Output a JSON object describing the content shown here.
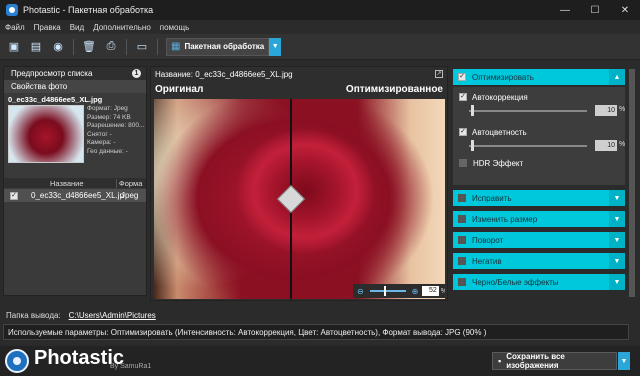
{
  "window": {
    "title": "Photastic - Пакетная обработка",
    "minimize": "—",
    "maximize": "☐",
    "close": "✕"
  },
  "menu": [
    "Файл",
    "Правка",
    "Вид",
    "Дополнительно",
    "помощь"
  ],
  "toolbar": {
    "mode_label": "Пакетная обработка",
    "icons": [
      "open-image-icon",
      "open-folder-icon",
      "webcam-icon",
      "delete-icon",
      "print-icon",
      "window-icon"
    ]
  },
  "left_panel": {
    "tab_preview": "Предпросмотр списка",
    "count": "1",
    "tab_props": "Свойства фото",
    "thumb_name": "0_ec33c_d4866ee5_XL.jpg",
    "info": [
      "Формат: Jpeg",
      "Размер: 74 KB",
      "Разрешение: 800...",
      "Снятог -",
      "Камера: -",
      "Гео данные: -"
    ],
    "columns": [
      "Название",
      "Форма"
    ],
    "rows": [
      {
        "name": "0_ec33c_d4866ee5_XL.jp",
        "format": "Jpeg"
      }
    ]
  },
  "center": {
    "title": "Название: 0_ec33c_d4866ee5_XL.jpg",
    "label_original": "Оригинал",
    "label_optimized": "Оптимизированное",
    "zoom": "52",
    "zoom_unit": "%"
  },
  "right_panel": {
    "optimize": {
      "label": "Оптимизировать",
      "autocorrect": "Автокоррекция",
      "autocorrect_value": "10",
      "autocolor": "Автоцветность",
      "autocolor_value": "10",
      "unit": "%",
      "hdr": "HDR Эффект"
    },
    "sections": [
      "Исправить",
      "Изменить размер",
      "Поворот",
      "Негатив",
      "Черно/Белые эффекты"
    ]
  },
  "bottom": {
    "output_label": "Папка вывода:",
    "output_path": "C:\\Users\\Admin\\Pictures",
    "params": "Используемые параметры: Оптимизировать (Интенсивность: Автокоррекция, Цвет: Автоцветность), Формат вывода: JPG (90% )"
  },
  "footer": {
    "logo": "Photastic",
    "by": "By SamuRa1",
    "save_label": "Сохранить все изображения"
  },
  "colors": {
    "accent": "#00c8dc",
    "dropdown": "#2aa6d8"
  }
}
